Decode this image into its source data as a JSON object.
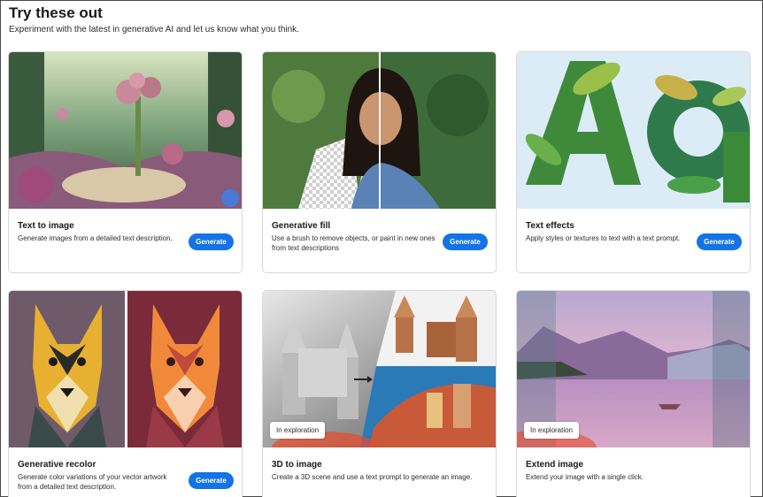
{
  "header": {
    "title": "Try these out",
    "subtitle": "Experiment with the latest in generative AI and let us know what you think."
  },
  "cards": [
    {
      "title": "Text to image",
      "description": "Generate images from a detailed text description.",
      "button": "Generate",
      "image": "fantasy-garden-image"
    },
    {
      "title": "Generative fill",
      "description": "Use a brush to remove objects, or paint in new ones from text descriptions",
      "button": "Generate",
      "image": "woman-portrait-image"
    },
    {
      "title": "Text effects",
      "description": "Apply styles or textures to text with a text prompt.",
      "button": "Generate",
      "image": "leafy-letters-image"
    },
    {
      "title": "Generative recolor",
      "description": "Generate color variations of your vector artwork from a detailed text description.",
      "button": "Generate",
      "image": "dog-vector-image"
    },
    {
      "title": "3D to image",
      "description": "Create a 3D scene and use a text prompt to generate an image.",
      "badge": "In exploration",
      "image": "castle-3d-image"
    },
    {
      "title": "Extend image",
      "description": "Extend your image with a single click.",
      "badge": "In exploration",
      "image": "lake-mountain-image"
    }
  ],
  "colors": {
    "accent": "#1473e6",
    "border": "#d9d9d9"
  }
}
